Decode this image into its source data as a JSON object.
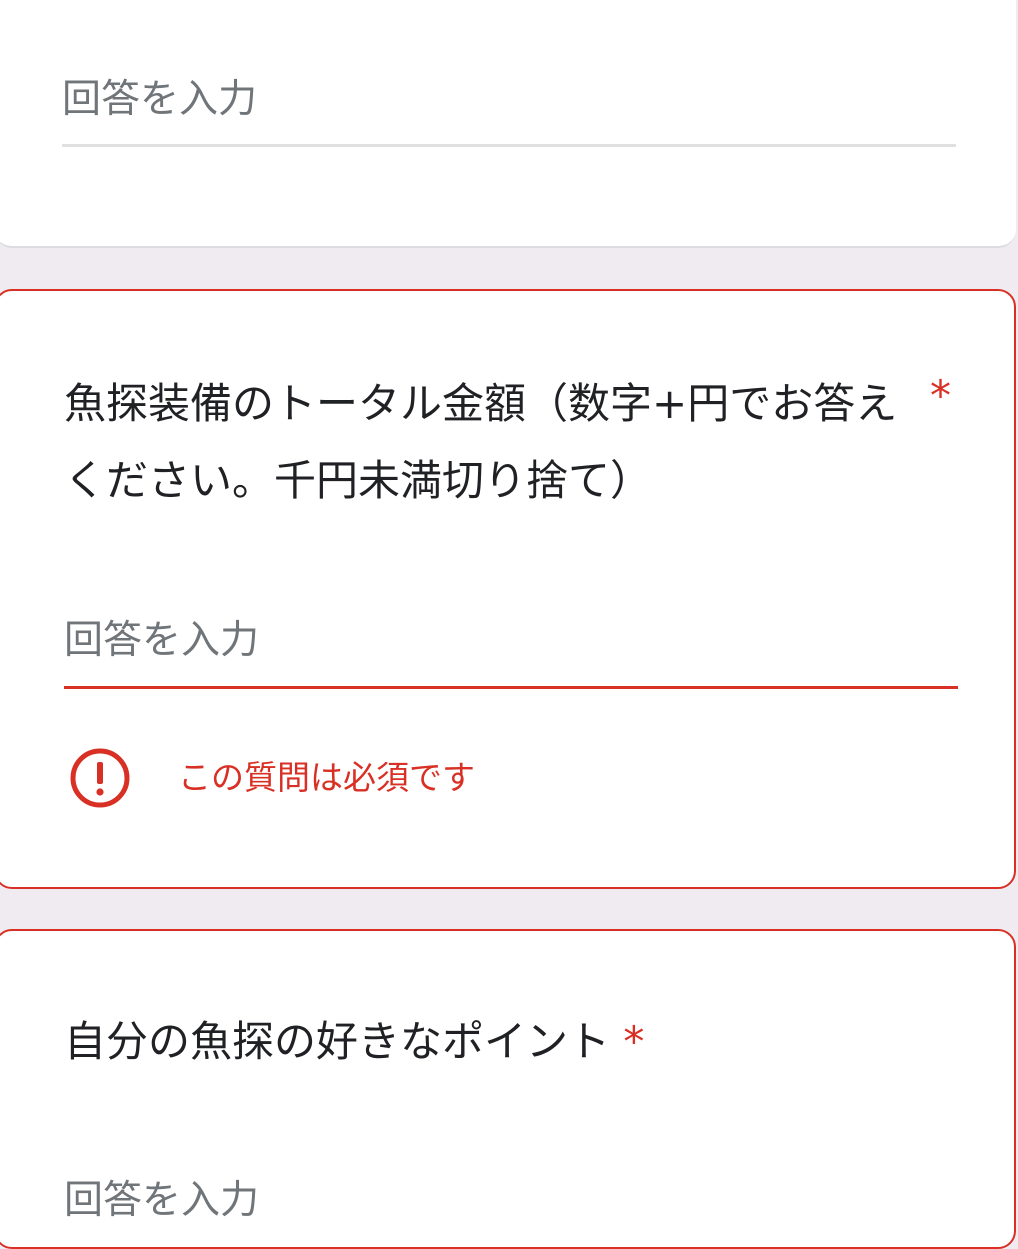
{
  "previous_question": {
    "placeholder": "回答を入力"
  },
  "question_total_amount": {
    "title": "魚探装備のトータル金額（数字+円でお答えください。千円未満切り捨て）",
    "required_mark": "*",
    "placeholder": "回答を入力",
    "error_message": "この質問は必須です",
    "error_icon": "alert-circle-icon"
  },
  "question_favorite_point": {
    "title": "自分の魚探の好きなポイント",
    "required_mark": "*",
    "placeholder": "回答を入力"
  },
  "colors": {
    "error": "#d93025",
    "background": "#f0ebf0",
    "text": "#202124",
    "placeholder": "#70757a"
  }
}
